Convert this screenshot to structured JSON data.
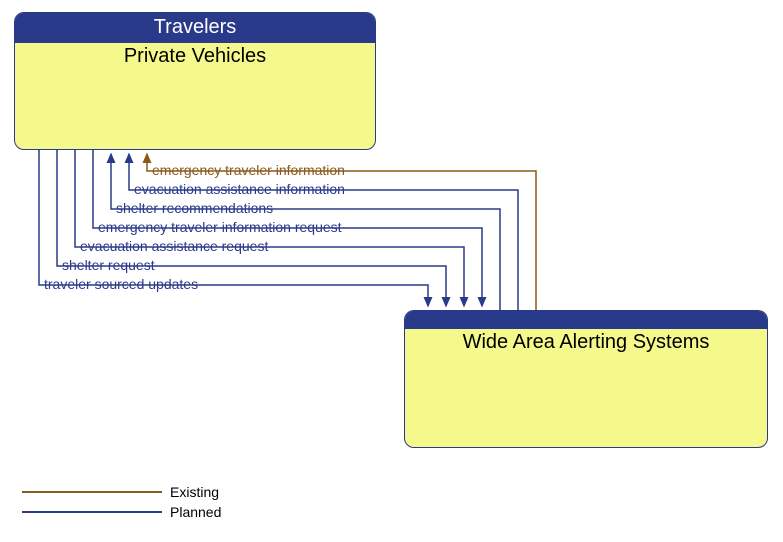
{
  "boxes": {
    "topLeft": {
      "header": "Travelers",
      "title": "Private Vehicles"
    },
    "bottomRight": {
      "header": "",
      "title": "Wide Area Alerting Systems"
    }
  },
  "flows": [
    {
      "label": "emergency traveler information",
      "status": "existing",
      "direction": "to_top"
    },
    {
      "label": "evacuation assistance information",
      "status": "planned",
      "direction": "to_top"
    },
    {
      "label": "shelter recommendations",
      "status": "planned",
      "direction": "to_top"
    },
    {
      "label": "emergency traveler information request",
      "status": "planned",
      "direction": "to_bottom"
    },
    {
      "label": "evacuation assistance request",
      "status": "planned",
      "direction": "to_bottom"
    },
    {
      "label": "shelter request",
      "status": "planned",
      "direction": "to_bottom"
    },
    {
      "label": "traveler sourced updates",
      "status": "planned",
      "direction": "to_bottom"
    }
  ],
  "legend": {
    "existing": "Existing",
    "planned": "Planned"
  },
  "colors": {
    "existing": "#8a5a1a",
    "planned": "#2a3a8a",
    "boxFill": "#f5f88a",
    "boxHeader": "#2a3a8a"
  },
  "chart_data": {
    "type": "table",
    "title": "Information flows between Private Vehicles (Travelers) and Wide Area Alerting Systems",
    "nodes": [
      {
        "id": "private_vehicles",
        "label": "Private Vehicles",
        "group": "Travelers"
      },
      {
        "id": "wide_area_alerting",
        "label": "Wide Area Alerting Systems",
        "group": ""
      }
    ],
    "edges": [
      {
        "from": "wide_area_alerting",
        "to": "private_vehicles",
        "label": "emergency traveler information",
        "status": "Existing"
      },
      {
        "from": "wide_area_alerting",
        "to": "private_vehicles",
        "label": "evacuation assistance information",
        "status": "Planned"
      },
      {
        "from": "wide_area_alerting",
        "to": "private_vehicles",
        "label": "shelter recommendations",
        "status": "Planned"
      },
      {
        "from": "private_vehicles",
        "to": "wide_area_alerting",
        "label": "emergency traveler information request",
        "status": "Planned"
      },
      {
        "from": "private_vehicles",
        "to": "wide_area_alerting",
        "label": "evacuation assistance request",
        "status": "Planned"
      },
      {
        "from": "private_vehicles",
        "to": "wide_area_alerting",
        "label": "shelter request",
        "status": "Planned"
      },
      {
        "from": "private_vehicles",
        "to": "wide_area_alerting",
        "label": "traveler sourced updates",
        "status": "Planned"
      }
    ],
    "legend": {
      "Existing": "#8a5a1a",
      "Planned": "#2a3a8a"
    }
  }
}
